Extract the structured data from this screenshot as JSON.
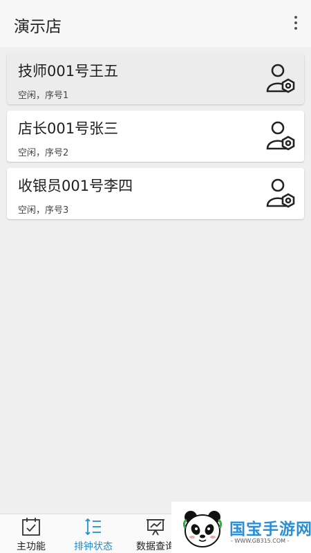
{
  "app_bar": {
    "title": "演示店",
    "more_icon": "more-vertical-icon"
  },
  "staff": [
    {
      "name": "技师001号王五",
      "status": "空闲，序号1",
      "icon": "user-gear-icon",
      "selected": true
    },
    {
      "name": "店长001号张三",
      "status": "空闲，序号2",
      "icon": "user-gear-icon",
      "selected": false
    },
    {
      "name": "收银员001号李四",
      "status": "空闲，序号3",
      "icon": "user-gear-icon",
      "selected": false
    }
  ],
  "bottom_nav": {
    "items": [
      {
        "label": "主功能",
        "icon": "calendar-check-icon",
        "active": false
      },
      {
        "label": "排钟状态",
        "icon": "sort-list-icon",
        "active": true
      },
      {
        "label": "数据查询",
        "icon": "presentation-chart-icon",
        "active": false
      }
    ]
  },
  "watermark": {
    "brand": "国宝手游网",
    "url": "- WWW.GB315.COM -"
  },
  "colors": {
    "accent": "#1e90d6",
    "background": "#efefef",
    "card": "#ffffff"
  }
}
